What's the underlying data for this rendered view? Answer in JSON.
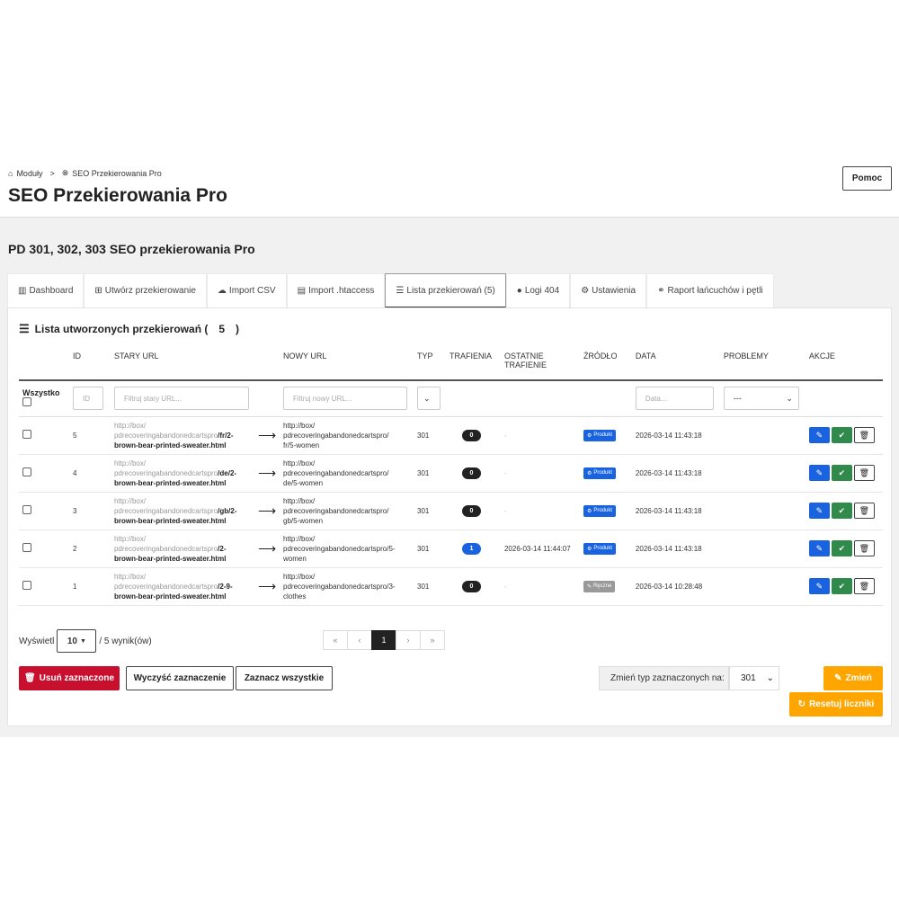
{
  "breadcrumb": {
    "modules": "Moduły",
    "current": "SEO Przekierowania Pro"
  },
  "page_title": "SEO Przekierowania Pro",
  "help_label": "Pomoc",
  "module_title": "PD 301, 302, 303 SEO przekierowania Pro",
  "tabs": [
    {
      "label": "Dashboard",
      "icon": "chart-icon"
    },
    {
      "label": "Utwórz przekierowanie",
      "icon": "plus-square-icon"
    },
    {
      "label": "Import CSV",
      "icon": "cloud-upload-icon"
    },
    {
      "label": "Import .htaccess",
      "icon": "file-icon"
    },
    {
      "label": "Lista przekierowań (5)",
      "icon": "list-icon",
      "active": true
    },
    {
      "label": "Logi 404",
      "icon": "info-circle-icon"
    },
    {
      "label": "Ustawienia",
      "icon": "gears-icon"
    },
    {
      "label": "Raport łańcuchów i pętli",
      "icon": "link-icon"
    }
  ],
  "list": {
    "title": "Lista utworzonych przekierowań (",
    "count": "5",
    "close": ")"
  },
  "columns": {
    "id": "ID",
    "old_url": "STARY URL",
    "new_url": "NOWY URL",
    "type": "TYP",
    "hits": "TRAFIENIA",
    "last_hit": "OSTATNIE TRAFIENIE",
    "source": "ŹRÓDŁO",
    "date": "DATA",
    "problems": "PROBLEMY",
    "actions": "AKCJE"
  },
  "filters": {
    "all_label": "Wszystko",
    "id_placeholder": "ID",
    "old_url_placeholder": "Filtruj stary URL...",
    "new_url_placeholder": "Filtruj nowy URL...",
    "date_placeholder": "Data...",
    "problems_value": "---"
  },
  "rows": [
    {
      "id": "5",
      "old_prefix1": "http://box/",
      "old_prefix2": "pdrecoveringabandonedcartspro",
      "old_bold": "/fr/2-",
      "old_line3": "brown-bear-printed-sweater.html",
      "new1": "http://box/",
      "new2": "pdrecoveringabandonedcartspro/",
      "new3": "fr/5-women",
      "type": "301",
      "hits": "0",
      "last_hit": "-",
      "source": "Produkt",
      "date": "2026-03-14 11:43:18"
    },
    {
      "id": "4",
      "old_prefix1": "http://box/",
      "old_prefix2": "pdrecoveringabandonedcartspro",
      "old_bold": "/de/2-",
      "old_line3": "brown-bear-printed-sweater.html",
      "new1": "http://box/",
      "new2": "pdrecoveringabandonedcartspro/",
      "new3": "de/5-women",
      "type": "301",
      "hits": "0",
      "last_hit": "-",
      "source": "Produkt",
      "date": "2026-03-14 11:43:18"
    },
    {
      "id": "3",
      "old_prefix1": "http://box/",
      "old_prefix2": "pdrecoveringabandonedcartspro",
      "old_bold": "/gb/2-",
      "old_line3": "brown-bear-printed-sweater.html",
      "new1": "http://box/",
      "new2": "pdrecoveringabandonedcartspro/",
      "new3": "gb/5-women",
      "type": "301",
      "hits": "0",
      "last_hit": "-",
      "source": "Produkt",
      "date": "2026-03-14 11:43:18"
    },
    {
      "id": "2",
      "old_prefix1": "http://box/",
      "old_prefix2": "pdrecoveringabandonedcartspro",
      "old_bold": "/2-",
      "old_line3": "brown-bear-printed-sweater.html",
      "new1": "http://box/",
      "new2": "pdrecoveringabandonedcartspro/5-",
      "new3": "women",
      "type": "301",
      "hits": "1",
      "last_hit": "2026-03-14 11:44:07",
      "source": "Produkt",
      "date": "2026-03-14 11:43:18"
    },
    {
      "id": "1",
      "old_prefix1": "http://box/",
      "old_prefix2": "pdrecoveringabandonedcartspro",
      "old_bold": "/2-9-",
      "old_line3": "brown-bear-printed-sweater.html",
      "new1": "http://box/",
      "new2": "pdrecoveringabandonedcartspro/3-",
      "new3": "clothes",
      "type": "301",
      "hits": "0",
      "last_hit": "-",
      "source": "Ręczne",
      "date": "2026-03-14 10:28:48"
    }
  ],
  "footer": {
    "show_label": "Wyświetl",
    "per_page": "10",
    "results": "/ 5 wynik(ów)",
    "pager": [
      "«",
      "‹",
      "1",
      "›",
      "»"
    ],
    "delete_selected": "Usuń zaznaczone",
    "clear_selection": "Wyczyść zaznaczenie",
    "select_all": "Zaznacz wszystkie",
    "change_type_label": "Zmień typ zaznaczonych na:",
    "change_type_value": "301",
    "change_button": "Zmień",
    "reset_counters": "Resetuj liczniki"
  },
  "colors": {
    "blue": "#1a63e0",
    "green": "#2f8a4b",
    "red": "#c8102e",
    "orange": "#ffa500"
  }
}
